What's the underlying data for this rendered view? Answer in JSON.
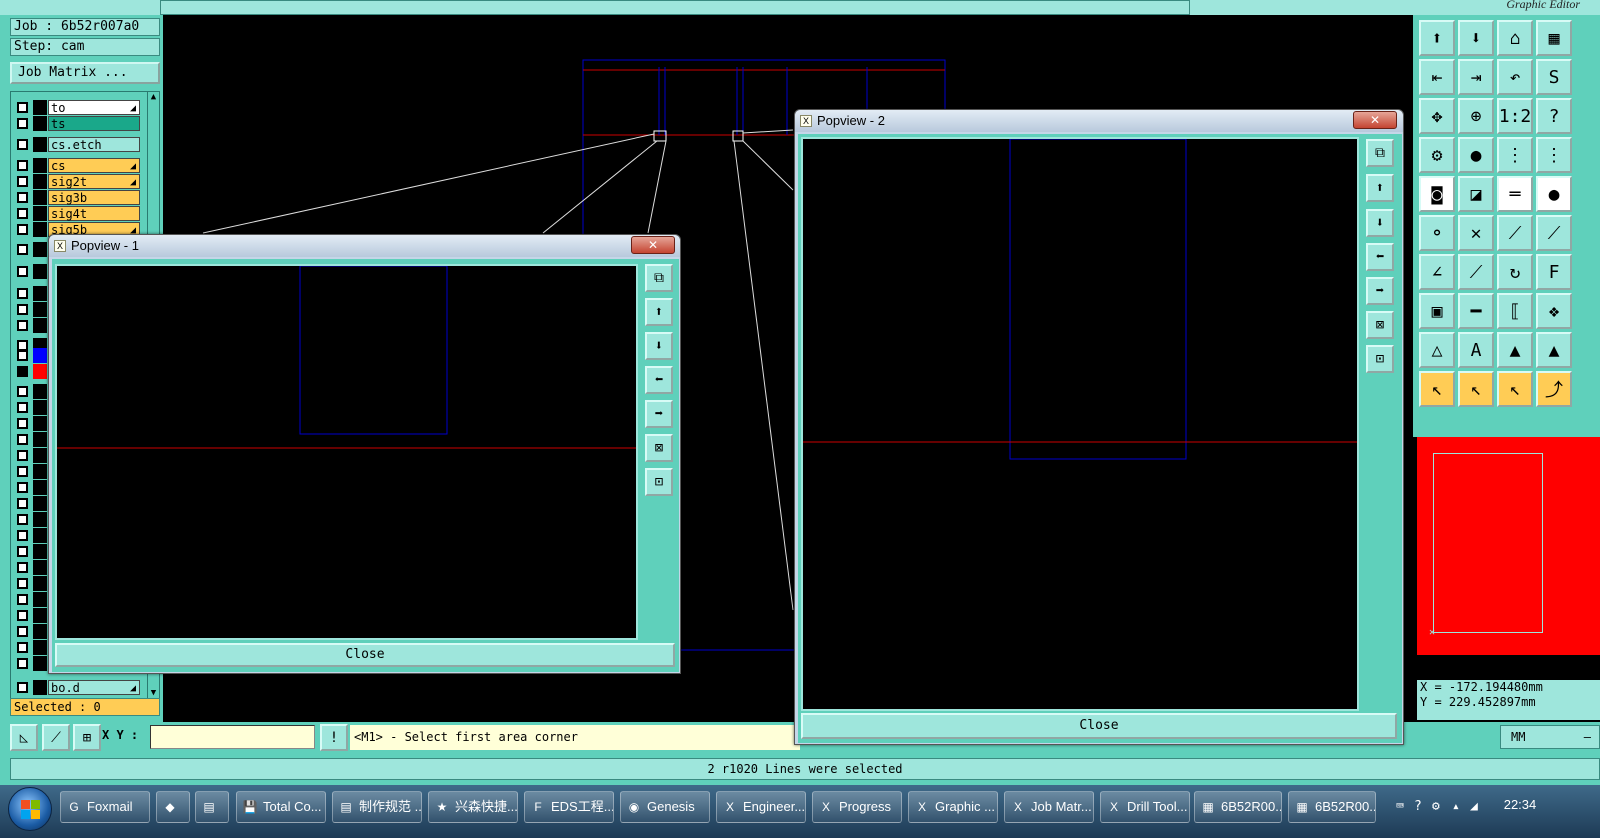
{
  "window": {
    "title": "Graphic Editor"
  },
  "job": {
    "job_label": "Job : 6b52r007a0",
    "step_label": "Step: cam"
  },
  "job_matrix_button": "Job Matrix ...",
  "layers": [
    {
      "name": "to",
      "color": "white",
      "has_arrow": true
    },
    {
      "name": "ts",
      "color": "teal",
      "has_arrow": false
    },
    {
      "name": "cs.etch",
      "color": "lteal",
      "has_arrow": false
    },
    {
      "name": "cs",
      "color": "orange",
      "has_arrow": true
    },
    {
      "name": "sig2t",
      "color": "orange",
      "has_arrow": true
    },
    {
      "name": "sig3b",
      "color": "orange",
      "has_arrow": false
    },
    {
      "name": "sig4t",
      "color": "orange",
      "has_arrow": false
    },
    {
      "name": "sig5b",
      "color": "orange",
      "has_arrow": true
    },
    {
      "name": "bo.d",
      "color": "lteal",
      "has_arrow": true
    }
  ],
  "selected_label": "Selected : 0",
  "command": {
    "xy_label": "X Y :",
    "xy_value": "",
    "prompt": "<M1> - Select first area corner",
    "units": "MM"
  },
  "status_message": "2 r1020 Lines were selected",
  "coords": {
    "x": "X = -172.194480mm",
    "y": "Y = 229.452897mm"
  },
  "popview1": {
    "title": "Popview - 1",
    "close_label": "Close",
    "x_glyph": "✕"
  },
  "popview2": {
    "title": "Popview - 2",
    "close_label": "Close",
    "x_glyph": "✕"
  },
  "taskbar": {
    "items": [
      {
        "label": "Foxmail",
        "icon": "foxmail-icon"
      },
      {
        "label": "",
        "icon": "app-icon"
      },
      {
        "label": "",
        "icon": "calculator-icon"
      },
      {
        "label": "Total Co...",
        "icon": "floppy-icon"
      },
      {
        "label": "制作规范 ...",
        "icon": "document-icon"
      },
      {
        "label": "兴森快捷...",
        "icon": "star-icon"
      },
      {
        "label": "EDS工程...",
        "icon": "f-icon"
      },
      {
        "label": "Genesis",
        "icon": "genesis-icon"
      },
      {
        "label": "Engineer...",
        "icon": "x-window-icon"
      },
      {
        "label": "Progress",
        "icon": "x-window-icon"
      },
      {
        "label": "Graphic ...",
        "icon": "x-window-icon"
      },
      {
        "label": "Job Matr...",
        "icon": "x-window-icon"
      },
      {
        "label": "Drill Tool...",
        "icon": "x-window-icon"
      },
      {
        "label": "6B52R00...",
        "icon": "pcb-icon"
      },
      {
        "label": "6B52R00...",
        "icon": "pcb-icon"
      }
    ],
    "clock": "22:34"
  }
}
